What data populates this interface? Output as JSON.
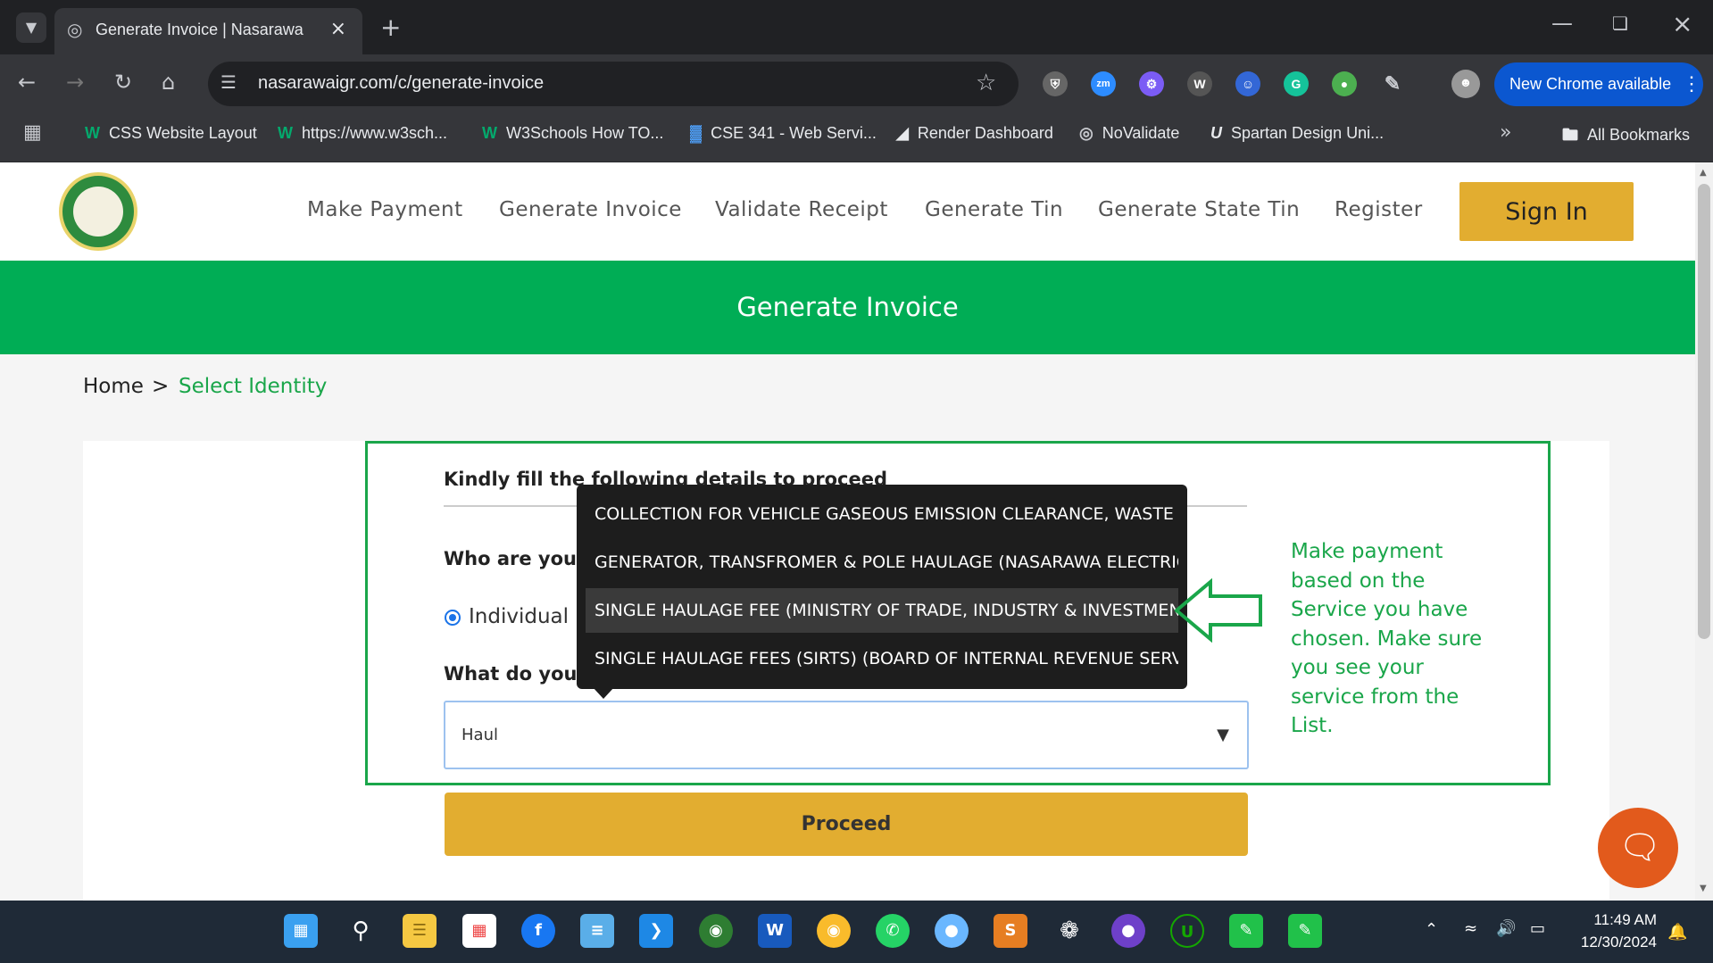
{
  "browser": {
    "tab_title": "Generate Invoice | Nasarawa",
    "url": "nasarawaigr.com/c/generate-invoice",
    "new_chrome": "New Chrome available",
    "bookmarks": [
      {
        "label": "CSS Website Layout",
        "icon": "w3schools-icon"
      },
      {
        "label": "https://www.w3sch...",
        "icon": "w3schools-icon"
      },
      {
        "label": "W3Schools How TO...",
        "icon": "w3schools-icon"
      },
      {
        "label": "CSE 341 - Web Servi...",
        "icon": "chart-icon"
      },
      {
        "label": "Render Dashboard",
        "icon": "render-icon"
      },
      {
        "label": "NoValidate",
        "icon": "globe-icon"
      },
      {
        "label": "Spartan Design Uni...",
        "icon": "u-icon"
      }
    ],
    "all_bookmarks": "All Bookmarks"
  },
  "nav": {
    "items": [
      "Make Payment",
      "Generate Invoice",
      "Validate Receipt",
      "Generate Tin",
      "Generate State Tin",
      "Register"
    ],
    "sign_in": "Sign In"
  },
  "banner": {
    "title": "Generate Invoice"
  },
  "breadcrumb": {
    "home": "Home",
    "sep": ">",
    "current": "Select Identity"
  },
  "form": {
    "heading": "Kindly fill the following details to proceed",
    "who_label": "Who are you",
    "radio_label": "Individual",
    "what_label": "What do you",
    "select_value": "Haul",
    "proceed": "Proceed"
  },
  "dropdown": {
    "options": [
      "COLLECTION FOR VEHICLE GASEOUS EMISSION CLEARANCE, WASTE BAS",
      "GENERATOR, TRANSFROMER & POLE HAULAGE (NASARAWA ELECTRICITY",
      "SINGLE HAULAGE FEE (MINISTRY OF TRADE, INDUSTRY & INVESTMENT)",
      "SINGLE HAULAGE FEES (SIRTS) (BOARD OF INTERNAL REVENUE SERVICE)"
    ],
    "highlighted_index": 2
  },
  "annotation": {
    "note": "Make payment based on the Service you have chosen. Make sure you see your service from the List.",
    "color": "#1aa64a"
  },
  "taskbar": {
    "time": "11:49 AM",
    "date": "12/30/2024"
  },
  "colors": {
    "green": "#00ad55",
    "gold": "#e2ad30",
    "chrome_dark": "#202124",
    "chrome_toolbar": "#35363a"
  }
}
